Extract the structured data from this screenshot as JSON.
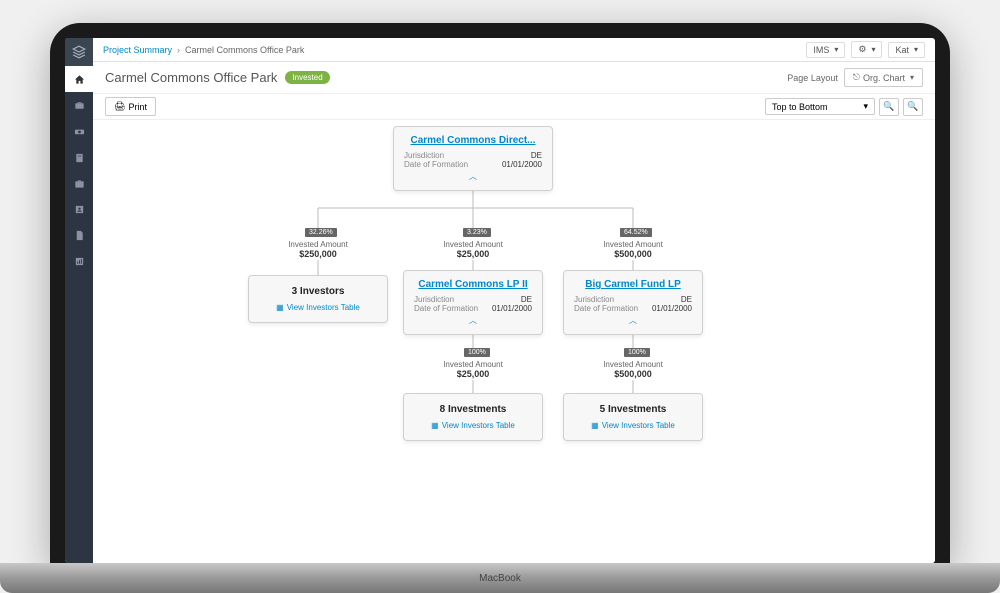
{
  "laptop_brand": "MacBook",
  "topbar": {
    "link": "Project Summary",
    "current": "Carmel Commons Office Park",
    "ims": "IMS",
    "user": "Kat"
  },
  "title": {
    "text": "Carmel Commons Office Park",
    "badge": "Invested",
    "page_layout": "Page Layout",
    "org_chart": "Org. Chart"
  },
  "toolbar": {
    "print": "Print",
    "direction": "Top to Bottom"
  },
  "labels": {
    "jur": "Jurisdiction",
    "dof": "Date of Formation",
    "inv_amt": "Invested Amount",
    "view": "View Investors Table"
  },
  "root": {
    "name": "Carmel Commons Direct...",
    "jur": "DE",
    "dof": "01/01/2000"
  },
  "branches": [
    {
      "pct": "32.26%",
      "amt": "$250,000",
      "summary": "3 Investors"
    },
    {
      "pct": "3.23%",
      "amt": "$25,000",
      "name": "Carmel Commons LP II",
      "jur": "DE",
      "dof": "01/01/2000",
      "sub": {
        "pct": "100%",
        "amt": "$25,000",
        "summary": "8 Investments"
      }
    },
    {
      "pct": "64.52%",
      "amt": "$500,000",
      "name": "Big Carmel Fund LP",
      "jur": "DE",
      "dof": "01/01/2000",
      "sub": {
        "pct": "100%",
        "amt": "$500,000",
        "summary": "5 Investments"
      }
    }
  ]
}
